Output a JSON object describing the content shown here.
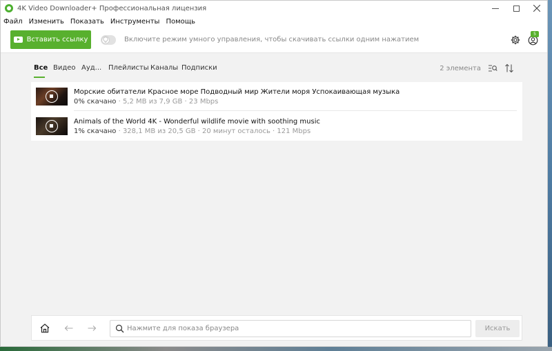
{
  "window": {
    "title": "4K Video Downloader+ Профессиональная лицензия"
  },
  "menu": [
    "Файл",
    "Изменить",
    "Показать",
    "Инструменты",
    "Помощь"
  ],
  "toolbar": {
    "paste_label": "Вставить ссылку",
    "smart_mode_text": "Включите режим умного управления, чтобы скачивать ссылки одним нажатием",
    "account_badge": "5"
  },
  "filters": {
    "tabs": [
      "Все",
      "Видео",
      "Ауд...",
      "Плейлисты",
      "Каналы",
      "Подписки"
    ],
    "active": "Все",
    "count": "2 элемента"
  },
  "downloads": [
    {
      "title": "Морские обитатели   Красное море   Подводный мир   Жители моря   Успокаивающая музыка",
      "percent": "0% скачано",
      "details": " · 5,2 MB из 7,9 GB · 23 Mbps",
      "progress": 0.0066
    },
    {
      "title": "Animals of the World 4K - Wonderful wildlife movie with soothing music",
      "percent": "1% скачано",
      "details": " · 328,1 MB из 20,5 GB · 20 минут осталось · 121 Mbps",
      "progress": 0.016
    }
  ],
  "browser": {
    "placeholder": "Нажмите для показа браузера",
    "search_label": "Искать"
  },
  "colors": {
    "accent": "#58b02e"
  }
}
